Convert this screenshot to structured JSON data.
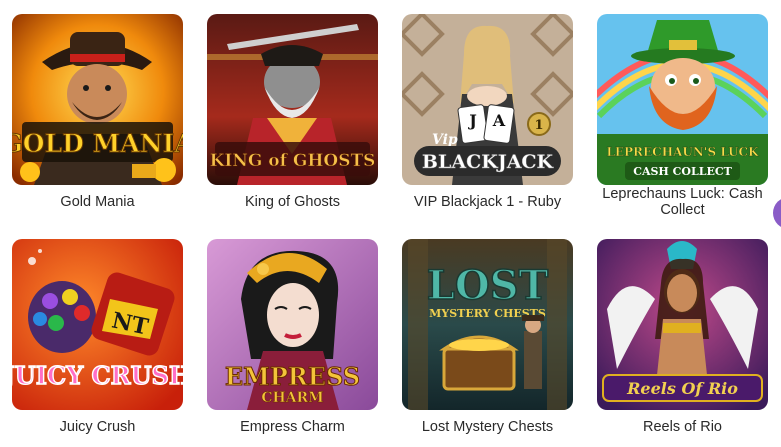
{
  "games": [
    {
      "title": "Gold Mania",
      "art_text": "GOLD MANIA",
      "colors": {
        "bg": "#e26a00",
        "accent": "#ffd12a"
      }
    },
    {
      "title": "King of Ghosts",
      "art_text": "KING of GHOSTS",
      "colors": {
        "bg": "#8a1f16",
        "accent": "#f0b23a"
      }
    },
    {
      "title": "VIP Blackjack 1 - Ruby",
      "art_text": "BLACKJACK",
      "art_sub": "Vip",
      "art_badge": "1",
      "colors": {
        "bg": "#b8a48c",
        "accent": "#2c2c2c"
      }
    },
    {
      "title": "Leprechauns Luck: Cash Collect",
      "art_text": "LEPRECHAUN'S LUCK",
      "art_sub": "CASH COLLECT",
      "colors": {
        "bg": "#4fb3e8",
        "accent": "#2f9a2a"
      }
    },
    {
      "title": "Juicy Crush",
      "art_text": "JUICY CRUSH",
      "art_badge": "NT",
      "colors": {
        "bg": "#f04a12",
        "accent": "#f7e34a"
      }
    },
    {
      "title": "Empress Charm",
      "art_text": "EMPRESS",
      "art_sub": "CHARM",
      "colors": {
        "bg": "#b26fc0",
        "accent": "#e9a820"
      }
    },
    {
      "title": "Lost Mystery Chests",
      "art_text": "LOST",
      "art_sub": "MYSTERY CHESTS",
      "colors": {
        "bg": "#1e5160",
        "accent": "#4fb7a7"
      }
    },
    {
      "title": "Reels of Rio",
      "art_text": "Reels Of Rio",
      "colors": {
        "bg": "#5a2a78",
        "accent": "#c92c7c"
      }
    }
  ],
  "side_bubble": {
    "color": "#8a5cc7"
  }
}
